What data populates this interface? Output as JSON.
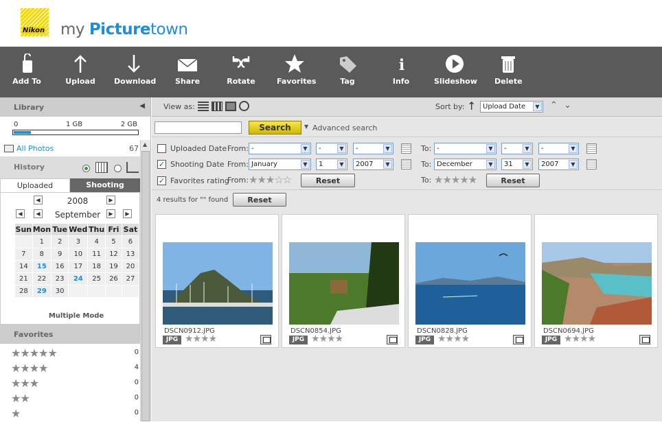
{
  "header": {
    "logo_text": "Nikon",
    "brand_my": "my ",
    "brand_picture": "Picture",
    "brand_town": "town"
  },
  "toolbar": {
    "items": [
      {
        "label": "Add To",
        "icon": "add-to-icon"
      },
      {
        "label": "Upload",
        "icon": "upload-arrow-icon"
      },
      {
        "label": "Download",
        "icon": "download-arrow-icon"
      },
      {
        "label": "Share",
        "icon": "envelope-icon"
      },
      {
        "label": "Rotate",
        "icon": "rotate-icon"
      },
      {
        "label": "Favorites",
        "icon": "star-icon"
      },
      {
        "label": "Tag",
        "icon": "tag-icon"
      },
      {
        "label": "Info",
        "icon": "info-icon"
      },
      {
        "label": "Slideshow",
        "icon": "play-icon"
      },
      {
        "label": "Delete",
        "icon": "trash-icon"
      }
    ]
  },
  "library": {
    "title": "Library",
    "storage_labels": [
      "0",
      "1 GB",
      "2 GB"
    ],
    "storage_used_fraction": 0.14,
    "all_photos_label": "All Photos",
    "all_photos_count": "67"
  },
  "history": {
    "title": "History",
    "tabs": [
      "Uploaded",
      "Shooting"
    ],
    "year": "2008",
    "month": "September",
    "weekdays": [
      "Sun",
      "Mon",
      "Tue",
      "Wed",
      "Thu",
      "Fri",
      "Sat"
    ],
    "weeks": [
      [
        "",
        "1",
        "2",
        "3",
        "4",
        "5",
        "6"
      ],
      [
        "7",
        "8",
        "9",
        "10",
        "11",
        "12",
        "13"
      ],
      [
        "14",
        "15",
        "16",
        "17",
        "18",
        "19",
        "20"
      ],
      [
        "21",
        "22",
        "23",
        "24",
        "25",
        "26",
        "27"
      ],
      [
        "28",
        "29",
        "30",
        "",
        "",
        "",
        ""
      ]
    ],
    "highlighted_days": [
      "15",
      "24",
      "29"
    ],
    "multiple_mode_label": "Multiple Mode"
  },
  "favorites": {
    "title": "Favorites",
    "rows": [
      {
        "stars": "★★★★★",
        "count": "0"
      },
      {
        "stars": "★★★★",
        "count": "4"
      },
      {
        "stars": "★★★",
        "count": "0"
      },
      {
        "stars": "★★",
        "count": "0"
      },
      {
        "stars": "★",
        "count": "0"
      }
    ]
  },
  "viewbar": {
    "view_as_label": "View as:",
    "sort_by_label": "Sort by:",
    "sort_value": "Upload Date"
  },
  "search": {
    "input_value": "",
    "button_label": "Search",
    "advanced_label": "Advanced search"
  },
  "filters": {
    "uploaded_label": "Uploaded Date",
    "shooting_label": "Shooting Date",
    "favorites_label": "Favorites rating",
    "from_label": "From:",
    "to_label": "To:",
    "uploaded_from": [
      "-",
      "-",
      "-"
    ],
    "uploaded_to": [
      "-",
      "-",
      "-"
    ],
    "shooting_from": [
      "January",
      "1",
      "2007"
    ],
    "shooting_to": [
      "December",
      "31",
      "2007"
    ],
    "from_stars": "★★★☆☆",
    "to_stars": "★★★★★",
    "reset_label": "Reset"
  },
  "results": {
    "text": "4 results for \"\" found",
    "reset_label": "Reset"
  },
  "photos": [
    {
      "name": "DSCN0912.JPG",
      "badge": "JPG",
      "stars": "★★★★"
    },
    {
      "name": "DSCN0854.JPG",
      "badge": "JPG",
      "stars": "★★★★"
    },
    {
      "name": "DSCN0828.JPG",
      "badge": "JPG",
      "stars": "★★★★"
    },
    {
      "name": "DSCN0694.JPG",
      "badge": "JPG",
      "stars": "★★★★"
    }
  ]
}
